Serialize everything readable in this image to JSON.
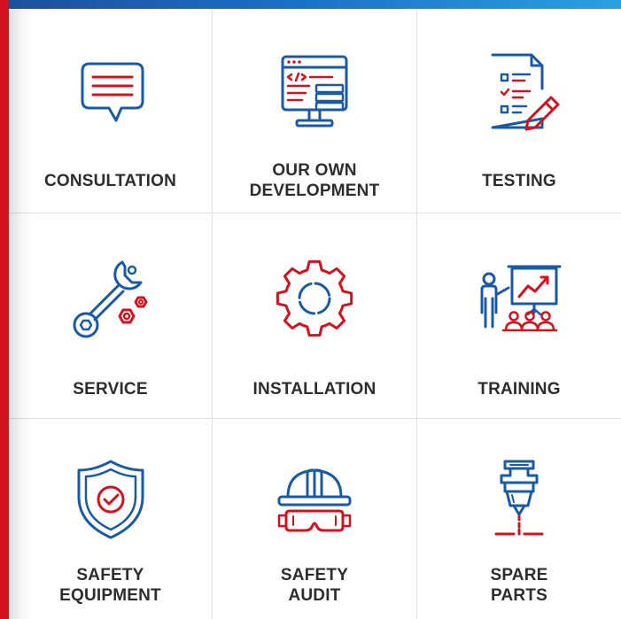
{
  "brand": {
    "blue": "#1a5aa5",
    "red": "#d6111e",
    "text": "#2d2d2d"
  },
  "tiles": [
    {
      "label": "CONSULTATION",
      "icon": "chat-bubble-icon"
    },
    {
      "label": "OUR OWN\nDEVELOPMENT",
      "icon": "code-monitor-icon"
    },
    {
      "label": "TESTING",
      "icon": "checklist-icon"
    },
    {
      "label": "SERVICE",
      "icon": "wrench-icon"
    },
    {
      "label": "INSTALLATION",
      "icon": "gear-icon"
    },
    {
      "label": "TRAINING",
      "icon": "presentation-icon"
    },
    {
      "label": "SAFETY\nEQUIPMENT",
      "icon": "shield-check-icon"
    },
    {
      "label": "SAFETY\nAUDIT",
      "icon": "hard-hat-goggles-icon"
    },
    {
      "label": "SPARE\nPARTS",
      "icon": "nozzle-icon"
    }
  ]
}
